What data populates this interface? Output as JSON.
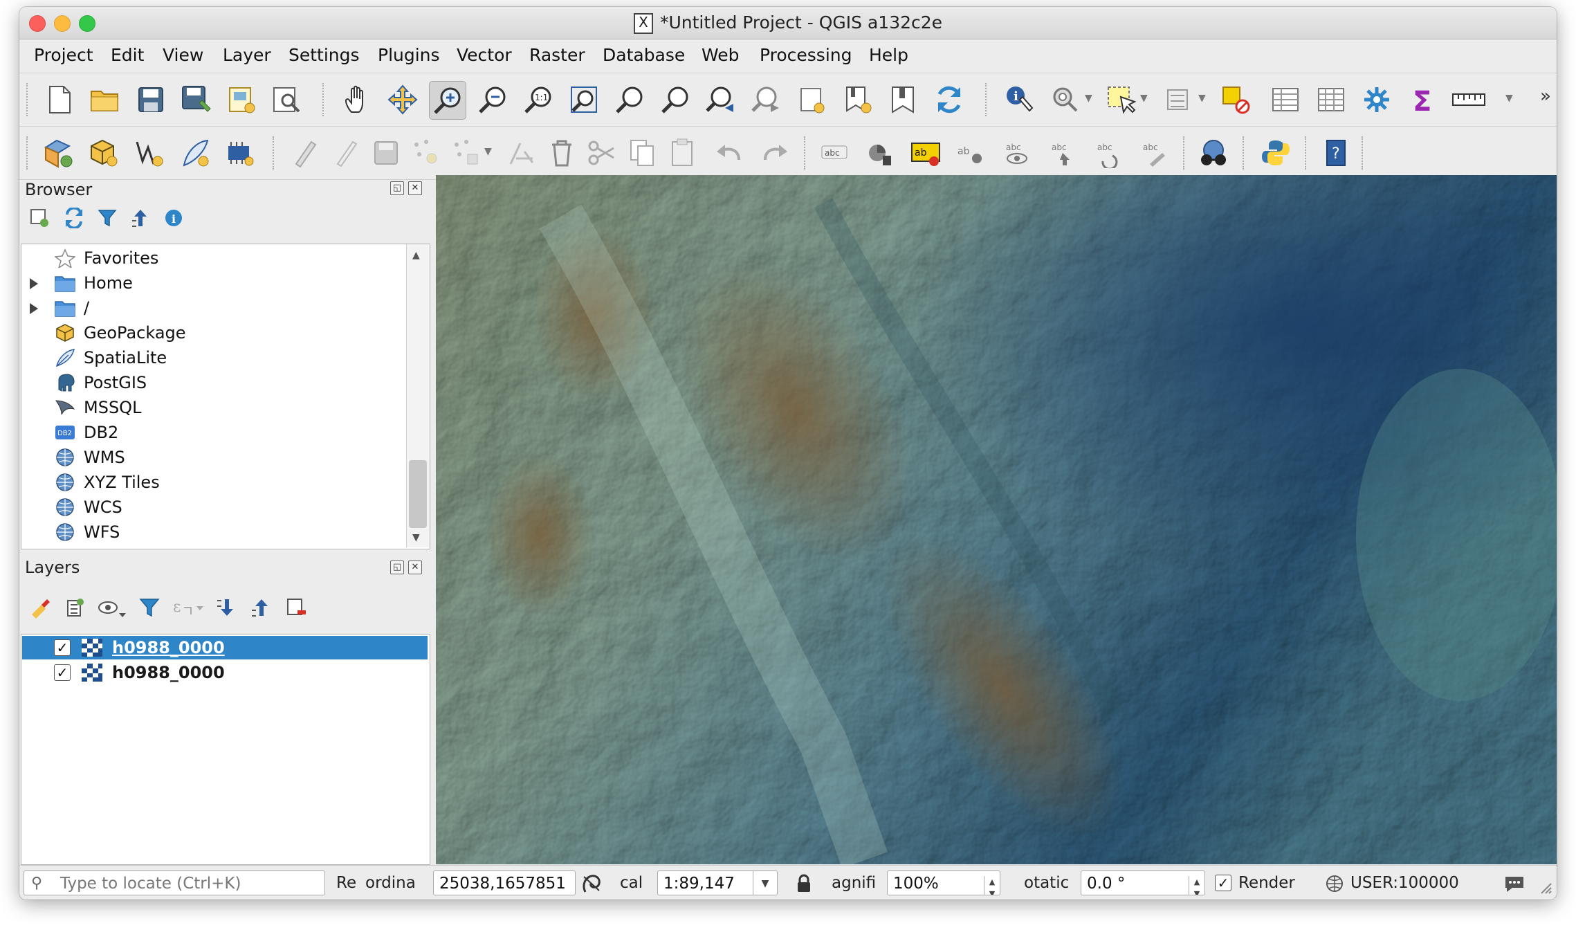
{
  "window": {
    "title": "*Untitled Project - QGIS a132c2e"
  },
  "menu": [
    "Project",
    "Edit",
    "View",
    "Layer",
    "Settings",
    "Plugins",
    "Vector",
    "Raster",
    "Database",
    "Web",
    "Processing",
    "Help"
  ],
  "toolbar": {
    "overflow": "»"
  },
  "browser": {
    "title": "Browser",
    "items": [
      {
        "label": "Favorites",
        "icon": "star-icon",
        "expandable": false
      },
      {
        "label": "Home",
        "icon": "folder-icon",
        "expandable": true
      },
      {
        "label": "/",
        "icon": "folder-icon",
        "expandable": true
      },
      {
        "label": "GeoPackage",
        "icon": "geopackage-icon",
        "expandable": false
      },
      {
        "label": "SpatiaLite",
        "icon": "feather-icon",
        "expandable": false
      },
      {
        "label": "PostGIS",
        "icon": "elephant-icon",
        "expandable": false
      },
      {
        "label": "MSSQL",
        "icon": "mssql-icon",
        "expandable": false
      },
      {
        "label": "DB2",
        "icon": "db2-icon",
        "expandable": false
      },
      {
        "label": "WMS",
        "icon": "globe-icon",
        "expandable": false
      },
      {
        "label": "XYZ Tiles",
        "icon": "globe-icon",
        "expandable": false
      },
      {
        "label": "WCS",
        "icon": "globe-icon",
        "expandable": false
      },
      {
        "label": "WFS",
        "icon": "globe-icon",
        "expandable": false
      }
    ]
  },
  "layers": {
    "title": "Layers",
    "items": [
      {
        "label": "h0988_0000",
        "checked": true,
        "selected": true
      },
      {
        "label": "h0988_0000",
        "checked": true,
        "selected": false
      }
    ]
  },
  "statusbar": {
    "locate_placeholder": "Type to locate (Ctrl+K)",
    "render_short": "Re",
    "coordinate_label": "ordina",
    "coordinate_value": "25038,1657851",
    "scale_label": "cal",
    "scale_value": "1:89,147",
    "magnifier_label": "agnifi",
    "magnifier_value": "100%",
    "rotation_label": "otatic",
    "rotation_value": "0.0 °",
    "render_label": "Render",
    "render_checked": true,
    "crs": "USER:100000"
  }
}
